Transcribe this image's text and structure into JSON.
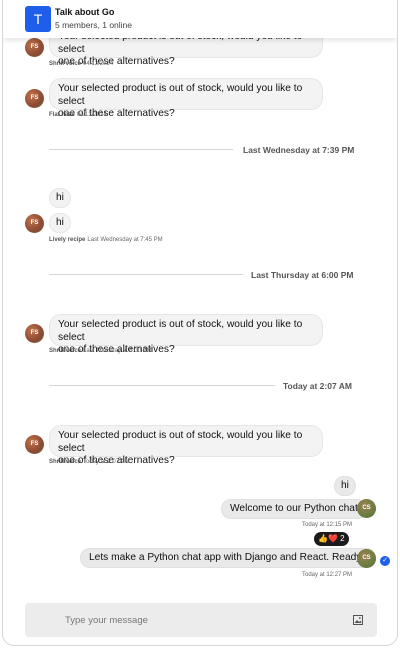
{
  "header": {
    "avatar_letter": "T",
    "title": "Talk about Go",
    "subtitle": "5 members, 1 online"
  },
  "messages": [
    {
      "text_line1": "Your selected product is out of stock, would you like to select",
      "text_line2": "one of these alternatives?",
      "avatar": "FS",
      "author": "Shrill voice",
      "time": "04/13/2024"
    },
    {
      "text_line1": "Your selected product is out of stock, would you like to select",
      "text_line2": "one of these alternatives?",
      "avatar": "FS",
      "author": "Flat haze",
      "time": "04/13/2024"
    },
    {
      "text": "hi"
    },
    {
      "text": "hi",
      "avatar": "FS",
      "author": "Lively recipe",
      "time": "Last Wednesday at 7:45 PM"
    },
    {
      "text_line1": "Your selected product is out of stock, would you like to select",
      "text_line2": "one of these alternatives?",
      "avatar": "FS",
      "author": "Shrill voice",
      "time": "Last Thursday at 6:00 PM"
    },
    {
      "text_line1": "Your selected product is out of stock, would you like to select",
      "text_line2": "one of these alternatives?",
      "avatar": "FS",
      "author": "Shrill voice",
      "time": "Today at 2:07 AM"
    }
  ],
  "dividers": [
    "Last Wednesday at 7:39 PM",
    "Last Thursday at 6:00 PM",
    "Today at 2:07 AM"
  ],
  "outgoing": [
    {
      "text": "hi"
    },
    {
      "text": "Welcome to our Python chat",
      "avatar": "CS",
      "time": "Today at 12:15 PM"
    },
    {
      "text": "Lets make a Python chat app with Django and React. Ready?",
      "avatar": "CS",
      "time": "Today at 12:27 PM"
    }
  ],
  "reactions": {
    "emojis": "👍❤️",
    "count": "2"
  },
  "composer": {
    "placeholder": "Type your message"
  },
  "icons": {
    "read": "check-icon",
    "attach": "image-icon"
  },
  "colors": {
    "accent": "#1e5eea"
  }
}
